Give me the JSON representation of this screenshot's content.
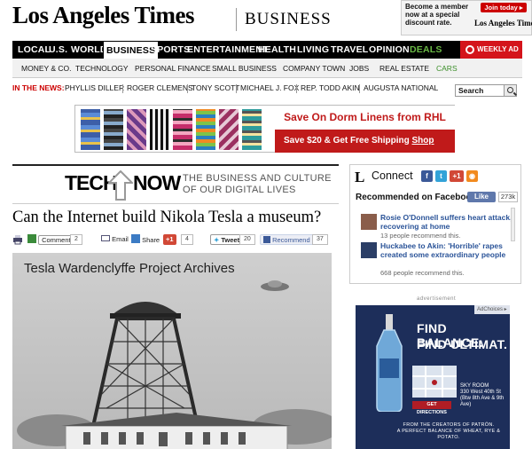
{
  "masthead": {
    "logo": "Los Angeles Times",
    "section": "BUSINESS",
    "promo": {
      "text": "Become a member now at a special discount rate.",
      "join_label": "Join today ▸",
      "logo": "Los Angeles Times"
    }
  },
  "nav": {
    "items": [
      "LOCAL",
      "U.S.",
      "WORLD",
      "BUSINESS",
      "SPORTS",
      "ENTERTAINMENT",
      "HEALTH",
      "LIVING",
      "TRAVEL",
      "OPINION",
      "DEALS"
    ],
    "weekly_ad": "WEEKLY AD"
  },
  "subnav": {
    "items": [
      "MONEY & CO.",
      "TECHNOLOGY",
      "PERSONAL FINANCE",
      "SMALL BUSINESS",
      "COMPANY TOWN",
      "JOBS",
      "REAL ESTATE",
      "CARS"
    ]
  },
  "in_the_news": {
    "label": "IN THE NEWS:",
    "items": [
      "PHYLLIS DILLER",
      "ROGER CLEMENS",
      "TONY SCOTT",
      "MICHAEL J. FOX",
      "REP. TODD AKIN",
      "AUGUSTA NATIONAL"
    ]
  },
  "search": {
    "value": "Search"
  },
  "banner_ad": {
    "headline": "Save On Dorm Linens from RHL",
    "offer": "Save $20 & Get Free Shipping",
    "cta": "Shop Now"
  },
  "blog": {
    "tech": "TECH",
    "now": "NOW",
    "tagline_1": "THE BUSINESS AND CULTURE",
    "tagline_2": "OF OUR DIGITAL LIVES"
  },
  "article": {
    "headline": "Can the Internet build Nikola Tesla a museum?",
    "photo_caption": "Tesla Wardenclyffe Project Archives"
  },
  "share_bar": {
    "comments_label": "Comments",
    "comments_count": "2",
    "email_label": "Email",
    "share_label": "Share",
    "gplus_label": "+1",
    "gplus_count": "4",
    "tweet_label": "Tweet",
    "tweet_count": "20",
    "recommend_label": "Recommend",
    "recommend_count": "37"
  },
  "connect": {
    "L": "L",
    "title": "Connect",
    "fb_heading": "Recommended on Facebook",
    "like_label": "Like",
    "like_count": "273k",
    "gplus": "+1",
    "items": [
      {
        "title": "Rosie O'Donnell suffers heart attack, recovering at home",
        "sub": "13 people recommend this."
      },
      {
        "title": "Huckabee to Akin: 'Horrible' rapes created some extraordinary people",
        "sub": "668 people recommend this."
      }
    ]
  },
  "right_ad": {
    "label": "advertisement",
    "adchoices": "AdChoices ▸",
    "line1": "FIND BALANCE.",
    "line2": "FIND ULTIMAT.",
    "sky_1": "SKY ROOM",
    "sky_2": "330 West 40th St",
    "sky_3": "(Btw 8th Ave & 9th Ave)",
    "directions": "GET DIRECTIONS",
    "footer_1": "FROM THE CREATORS OF PATRÓN.",
    "footer_2": "A PERFECT BALANCE OF WHEAT, RYE & POTATO."
  },
  "colors": {
    "brand_red": "#c00",
    "nav_black": "#000",
    "deals_green": "#6ab945",
    "facebook_blue": "#5f78ab"
  }
}
